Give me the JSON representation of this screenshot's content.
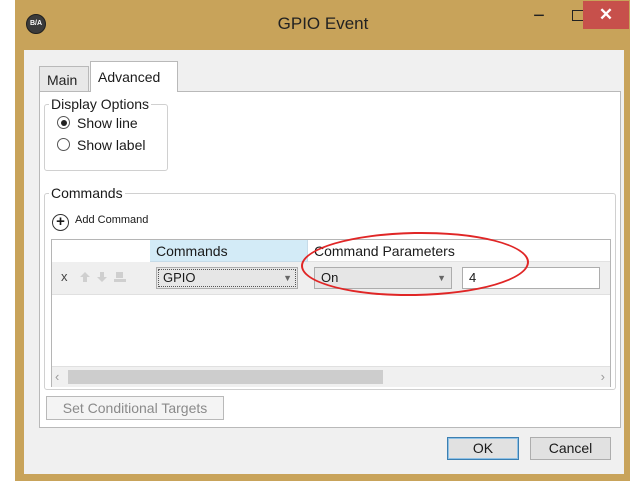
{
  "window": {
    "title": "GPIO Event",
    "app_icon_text": "B/A",
    "minimize_glyph": "−",
    "close_glyph": "✕",
    "colors": {
      "frame": "#c8a35a",
      "close": "#c7504b",
      "annotation": "#e02626",
      "header_highlight": "#d3ebf7"
    }
  },
  "tabs": [
    {
      "label": "Main",
      "selected": false
    },
    {
      "label": "Advanced",
      "selected": true
    }
  ],
  "display_options": {
    "title": "Display Options",
    "options": [
      {
        "label": "Show line",
        "checked": true
      },
      {
        "label": "Show label",
        "checked": false
      }
    ]
  },
  "commands": {
    "group_title": "Commands",
    "add_label": "Add Command",
    "add_glyph": "+",
    "headers": {
      "commands": "Commands",
      "params": "Command Parameters"
    },
    "row": {
      "delete": "x",
      "icons": [
        "arrow-up-icon",
        "arrow-down-icon",
        "target-icon"
      ],
      "command_value": "GPIO",
      "param_value": "On",
      "param_input": "4"
    },
    "scroll_left": "‹",
    "scroll_right": "›"
  },
  "buttons": {
    "set_targets": "Set Conditional Targets",
    "ok": "OK",
    "cancel": "Cancel"
  }
}
